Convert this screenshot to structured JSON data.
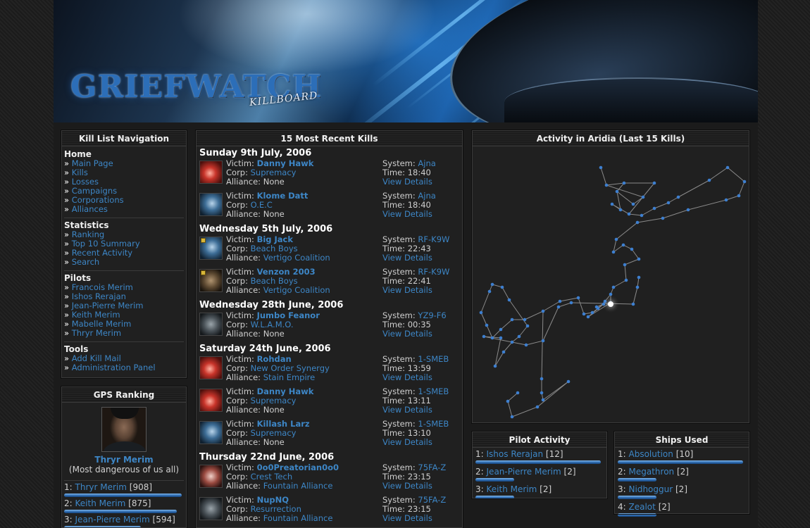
{
  "banner": {
    "logo": "GRIEFWATCH",
    "logo_sub": "KILLBOARD"
  },
  "nav": {
    "title": "Kill List Navigation",
    "sections": [
      {
        "heading": "Home",
        "items": [
          "Main Page",
          "Kills",
          "Losses",
          "Campaigns",
          "Corporations",
          "Alliances"
        ]
      },
      {
        "heading": "Statistics",
        "items": [
          "Ranking",
          "Top 10 Summary",
          "Recent Activity",
          "Search"
        ]
      },
      {
        "heading": "Pilots",
        "items": [
          "Francois Merim",
          "Ishos Rerajan",
          "Jean-Pierre Merim",
          "Keith Merim",
          "Mabelle Merim",
          "Thryr Merim"
        ]
      },
      {
        "heading": "Tools",
        "items": [
          "Add Kill Mail",
          "Administration Panel"
        ]
      }
    ]
  },
  "gps": {
    "title": "GPS Ranking",
    "top_name": "Thryr Merim",
    "top_caption": "(Most dangerous of us all)",
    "ranks": [
      {
        "pos": "1:",
        "name": "Thryr Merim",
        "score": "[908]",
        "fill": 0.98
      },
      {
        "pos": "2:",
        "name": "Keith Merim",
        "score": "[875]",
        "fill": 0.94
      },
      {
        "pos": "3:",
        "name": "Jean-Pierre Merim",
        "score": "[594]",
        "fill": 0.64
      }
    ]
  },
  "kills": {
    "title": "15 Most Recent Kills",
    "labels": {
      "victim": "Victim:",
      "corp": "Corp:",
      "alliance": "Alliance:",
      "system": "System:",
      "time": "Time:",
      "details": "View Details"
    },
    "days": [
      {
        "date": "Sunday 9th July, 2006",
        "entries": [
          {
            "victim": "Danny Hawk",
            "corp": "Supremacy",
            "alliance": "None",
            "system": "Ajna",
            "time": "18:40",
            "thumb": "red",
            "badge": false
          },
          {
            "victim": "Klome Datt",
            "corp": "O.E.C",
            "alliance": "None",
            "system": "Ajna",
            "time": "18:40",
            "thumb": "blue",
            "badge": false
          }
        ]
      },
      {
        "date": "Wednesday 5th July, 2006",
        "entries": [
          {
            "victim": "Big Jack",
            "corp": "Beach Boys",
            "alliance": "Vertigo Coalition",
            "system": "RF-K9W",
            "time": "22:43",
            "thumb": "blue",
            "badge": true
          },
          {
            "victim": "Venzon 2003",
            "corp": "Beach Boys",
            "alliance": "Vertigo Coalition",
            "system": "RF-K9W",
            "time": "22:41",
            "thumb": "brown",
            "badge": true
          }
        ]
      },
      {
        "date": "Wednesday 28th June, 2006",
        "entries": [
          {
            "victim": "Jumbo Feanor",
            "corp": "W.L.A.M.O.",
            "alliance": "None",
            "system": "YZ9-F6",
            "time": "00:35",
            "thumb": "gray",
            "badge": false
          }
        ]
      },
      {
        "date": "Saturday 24th June, 2006",
        "entries": [
          {
            "victim": "Rohdan",
            "corp": "New Order Synergy",
            "alliance": "Stain Empire",
            "system": "1-SMEB",
            "time": "13:59",
            "thumb": "red",
            "badge": false
          },
          {
            "victim": "Danny Hawk",
            "corp": "Supremacy",
            "alliance": "None",
            "system": "1-SMEB",
            "time": "13:11",
            "thumb": "red",
            "badge": false
          },
          {
            "victim": "Killash Larz",
            "corp": "Supremacy",
            "alliance": "None",
            "system": "1-SMEB",
            "time": "13:10",
            "thumb": "blue",
            "badge": false
          }
        ]
      },
      {
        "date": "Thursday 22nd June, 2006",
        "entries": [
          {
            "victim": "0o0Preatorian0o0",
            "corp": "Crest Tech",
            "alliance": "Fountain Alliance",
            "system": "75FA-Z",
            "time": "23:15",
            "thumb": "pink",
            "badge": false
          },
          {
            "victim": "NupNQ",
            "corp": "Resurrection",
            "alliance": "Fountain Alliance",
            "system": "75FA-Z",
            "time": "23:15",
            "thumb": "gray",
            "badge": false
          }
        ]
      }
    ]
  },
  "activity": {
    "title": "Activity in Aridia (Last 15 Kills)"
  },
  "pilot_activity": {
    "title": "Pilot Activity",
    "rows": [
      {
        "pos": "1:",
        "name": "Ishos Rerajan",
        "count": "[12]",
        "fill": 0.98
      },
      {
        "pos": "2:",
        "name": "Jean-Pierre Merim",
        "count": "[2]",
        "fill": 0.3
      },
      {
        "pos": "3:",
        "name": "Keith Merim",
        "count": "[2]",
        "fill": 0.3
      }
    ]
  },
  "ships_used": {
    "title": "Ships Used",
    "rows": [
      {
        "pos": "1:",
        "name": "Absolution",
        "count": "[10]",
        "fill": 0.98
      },
      {
        "pos": "2:",
        "name": "Megathron",
        "count": "[2]",
        "fill": 0.3
      },
      {
        "pos": "3:",
        "name": "Nidhoggur",
        "count": "[2]",
        "fill": 0.3
      },
      {
        "pos": "4:",
        "name": "Zealot",
        "count": "[2]",
        "fill": 0.3
      }
    ]
  },
  "colors": {
    "link": "#3d86c6",
    "bar": "#2a67ad",
    "map_dot": "#3d7fd0",
    "map_line": "#8a8a8a"
  }
}
